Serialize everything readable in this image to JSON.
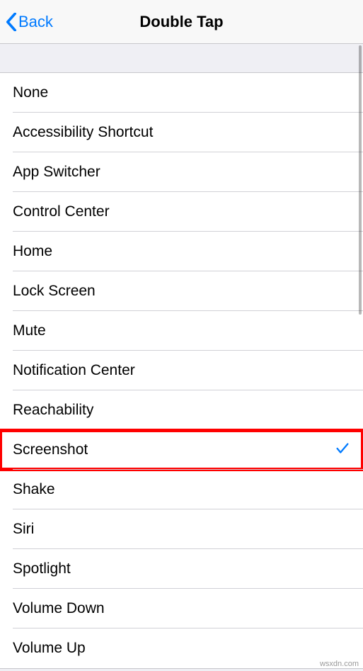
{
  "nav": {
    "back_label": "Back",
    "title": "Double Tap"
  },
  "options": [
    {
      "label": "None",
      "selected": false,
      "highlighted": false
    },
    {
      "label": "Accessibility Shortcut",
      "selected": false,
      "highlighted": false
    },
    {
      "label": "App Switcher",
      "selected": false,
      "highlighted": false
    },
    {
      "label": "Control Center",
      "selected": false,
      "highlighted": false
    },
    {
      "label": "Home",
      "selected": false,
      "highlighted": false
    },
    {
      "label": "Lock Screen",
      "selected": false,
      "highlighted": false
    },
    {
      "label": "Mute",
      "selected": false,
      "highlighted": false
    },
    {
      "label": "Notification Center",
      "selected": false,
      "highlighted": false
    },
    {
      "label": "Reachability",
      "selected": false,
      "highlighted": false
    },
    {
      "label": "Screenshot",
      "selected": true,
      "highlighted": true
    },
    {
      "label": "Shake",
      "selected": false,
      "highlighted": false
    },
    {
      "label": "Siri",
      "selected": false,
      "highlighted": false
    },
    {
      "label": "Spotlight",
      "selected": false,
      "highlighted": false
    },
    {
      "label": "Volume Down",
      "selected": false,
      "highlighted": false
    },
    {
      "label": "Volume Up",
      "selected": false,
      "highlighted": false
    }
  ],
  "watermark": "wsxdn.com"
}
